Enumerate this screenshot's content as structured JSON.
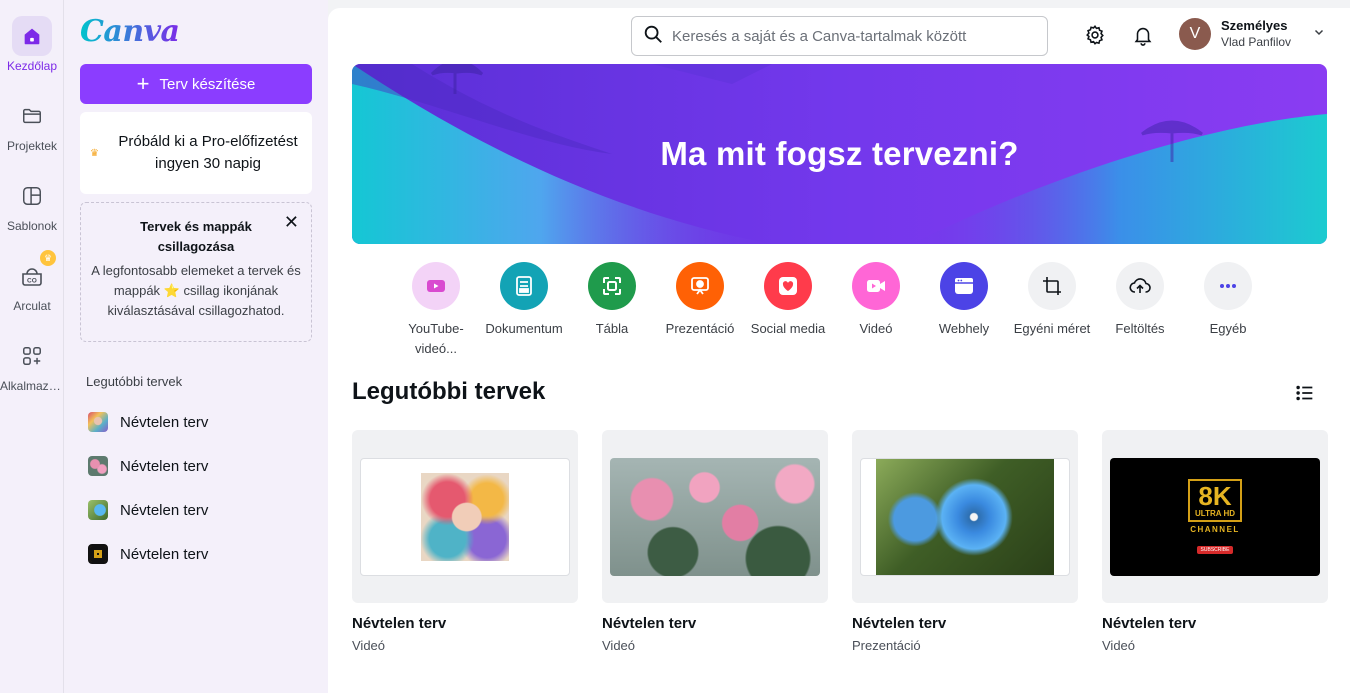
{
  "rail": {
    "items": [
      {
        "label": "Kezdőlap",
        "icon": "home-icon"
      },
      {
        "label": "Projektek",
        "icon": "folder-icon"
      },
      {
        "label": "Sablonok",
        "icon": "template-icon"
      },
      {
        "label": "Arculat",
        "icon": "brand-kit-icon"
      },
      {
        "label": "Alkalmazá...",
        "icon": "apps-icon"
      }
    ]
  },
  "panel": {
    "logo": "Canva",
    "create_button": "Terv készítése",
    "pro_promo": "Próbáld ki a Pro-előfizetést ingyen 30 napig",
    "star_card": {
      "title": "Tervek és mappák csillagozása",
      "body_before": "A legfontosabb elemeket a tervek és mappák",
      "body_after": "csillag ikonjának kiválasztásával csillagozhatod."
    },
    "recent_heading": "Legutóbbi tervek",
    "recent_items": [
      {
        "label": "Névtelen terv"
      },
      {
        "label": "Névtelen terv"
      },
      {
        "label": "Névtelen terv"
      },
      {
        "label": "Névtelen terv"
      }
    ]
  },
  "header": {
    "search_placeholder": "Keresés a saját és a Canva-tartalmak között",
    "account_type": "Személyes",
    "account_name": "Vlad Panfilov",
    "avatar_initial": "V"
  },
  "hero": {
    "title": "Ma mit fogsz tervezni?"
  },
  "quick_actions": [
    {
      "label": "YouTube-videó...",
      "color": "#f3d3f7",
      "icon": "youtube-icon"
    },
    {
      "label": "Dokumentum",
      "color": "#13a3b5",
      "icon": "document-icon"
    },
    {
      "label": "Tábla",
      "color": "#1f9b4c",
      "icon": "whiteboard-icon"
    },
    {
      "label": "Prezentáció",
      "color": "#ff6105",
      "icon": "presentation-icon"
    },
    {
      "label": "Social media",
      "color": "#ff3b4b",
      "icon": "heart-icon"
    },
    {
      "label": "Videó",
      "color": "#ff66d6",
      "icon": "video-icon"
    },
    {
      "label": "Webhely",
      "color": "#4c43e6",
      "icon": "website-icon"
    },
    {
      "label": "Egyéni méret",
      "color": "#f0f1f3",
      "icon": "custom-size-icon"
    },
    {
      "label": "Feltöltés",
      "color": "#f0f1f3",
      "icon": "upload-icon"
    },
    {
      "label": "Egyéb",
      "color": "#f0f1f3",
      "icon": "more-icon"
    }
  ],
  "recent_section": {
    "title": "Legutóbbi tervek",
    "cards": [
      {
        "title": "Névtelen terv",
        "type": "Videó",
        "thumb": "portrait-art"
      },
      {
        "title": "Névtelen terv",
        "type": "Videó",
        "thumb": "pink-flowers"
      },
      {
        "title": "Névtelen terv",
        "type": "Prezentáció",
        "thumb": "blue-flower"
      },
      {
        "title": "Névtelen terv",
        "type": "Videó",
        "thumb": "8k-channel"
      }
    ],
    "thumb_text": {
      "big": "8K",
      "sub1": "ULTRA HD",
      "sub2": "CHANNEL",
      "button": "SUBSCRIBE"
    }
  },
  "colors": {
    "accent": "#8b3dff",
    "rail_bg": "#f4f0fa"
  }
}
